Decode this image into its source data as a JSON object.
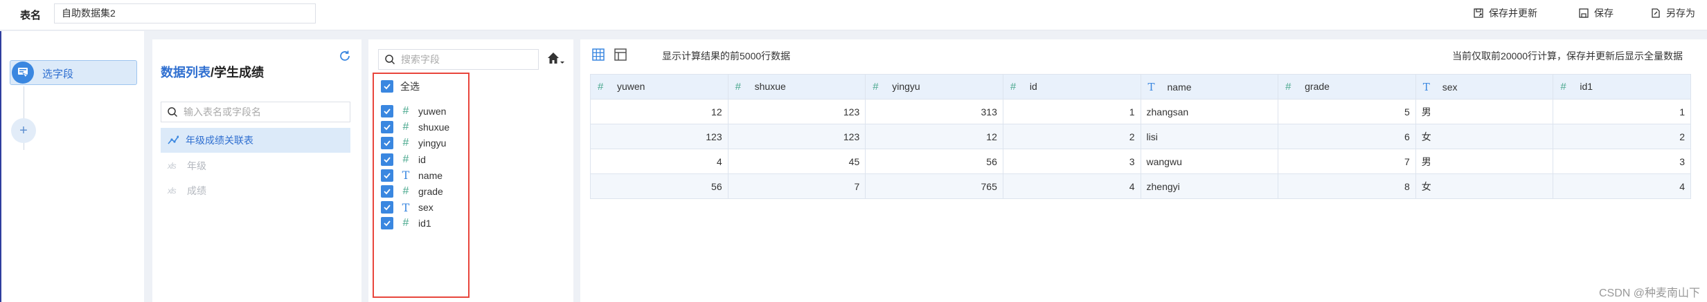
{
  "topbar": {
    "table_name_label": "表名",
    "table_name_value": "自助数据集2",
    "actions": {
      "save_update": "保存并更新",
      "save": "保存",
      "save_as": "另存为"
    }
  },
  "steps": {
    "current_step": "选字段",
    "add_icon": "plus-icon"
  },
  "data_list": {
    "title_link": "数据列表",
    "title_sep": "/",
    "title_current": "学生成绩",
    "search_placeholder": "输入表名或字段名",
    "items": [
      {
        "label": "年级成绩关联表",
        "icon": "relation-icon",
        "active": true
      },
      {
        "label": "年级",
        "icon": "xls-icon",
        "active": false
      },
      {
        "label": "成绩",
        "icon": "xls-icon",
        "active": false
      }
    ],
    "xls_text": "xls"
  },
  "fields": {
    "search_placeholder": "搜索字段",
    "select_all": "全选",
    "items": [
      {
        "name": "yuwen",
        "type": "#",
        "checked": true
      },
      {
        "name": "shuxue",
        "type": "#",
        "checked": true
      },
      {
        "name": "yingyu",
        "type": "#",
        "checked": true
      },
      {
        "name": "id",
        "type": "#",
        "checked": true
      },
      {
        "name": "name",
        "type": "T",
        "checked": true
      },
      {
        "name": "grade",
        "type": "#",
        "checked": true
      },
      {
        "name": "sex",
        "type": "T",
        "checked": true
      },
      {
        "name": "id1",
        "type": "#",
        "checked": true
      }
    ]
  },
  "preview": {
    "info": "显示计算结果的前5000行数据",
    "note": "当前仅取前20000行计算，保存并更新后显示全量数据",
    "columns": [
      {
        "name": "yuwen",
        "type": "#"
      },
      {
        "name": "shuxue",
        "type": "#"
      },
      {
        "name": "yingyu",
        "type": "#"
      },
      {
        "name": "id",
        "type": "#"
      },
      {
        "name": "name",
        "type": "T"
      },
      {
        "name": "grade",
        "type": "#"
      },
      {
        "name": "sex",
        "type": "T"
      },
      {
        "name": "id1",
        "type": "#"
      }
    ],
    "rows": [
      [
        "12",
        "123",
        "313",
        "1",
        "zhangsan",
        "5",
        "男",
        "1"
      ],
      [
        "123",
        "123",
        "12",
        "2",
        "lisi",
        "6",
        "女",
        "2"
      ],
      [
        "4",
        "45",
        "56",
        "3",
        "wangwu",
        "7",
        "男",
        "3"
      ],
      [
        "56",
        "7",
        "765",
        "4",
        "zhengyi",
        "8",
        "女",
        "4"
      ]
    ]
  },
  "watermark": "CSDN @种麦南山下",
  "colors": {
    "accent": "#3a87e0",
    "number_type": "#4aa88e",
    "highlight_border": "#e8453c"
  }
}
